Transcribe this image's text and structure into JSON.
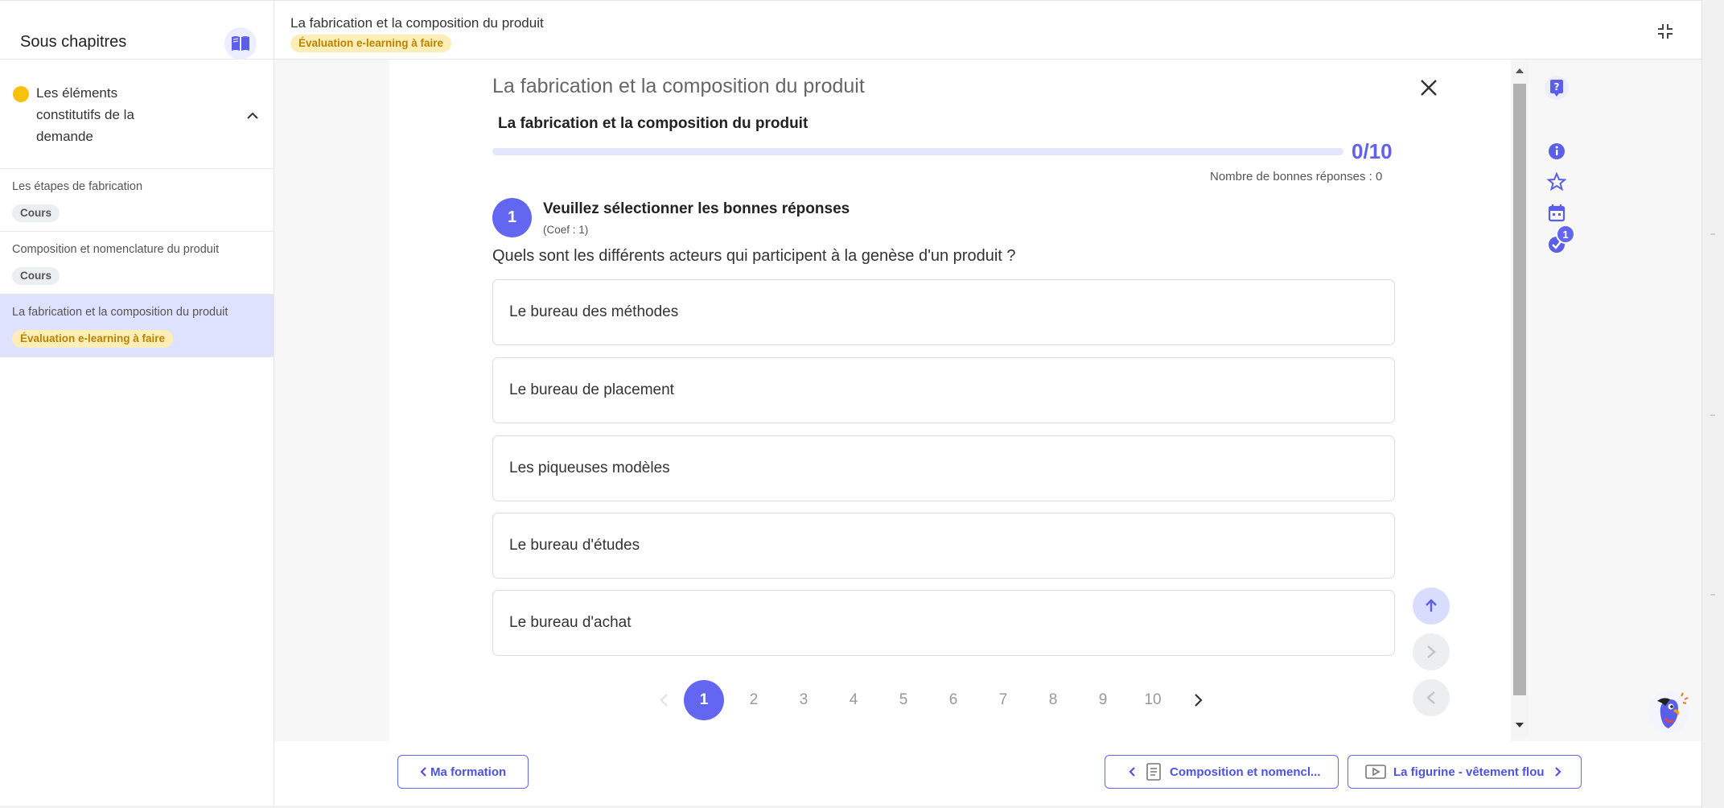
{
  "sidebar": {
    "title": "Sous chapitres",
    "chapter": {
      "label": "Les éléments constitutifs de la demande"
    },
    "items": [
      {
        "label": "Les étapes de fabrication",
        "badge": "Cours",
        "badge_type": "grey"
      },
      {
        "label": "Composition et nomenclature du produit",
        "badge": "Cours",
        "badge_type": "grey"
      },
      {
        "label": "La fabrication et la composition du produit",
        "badge": "Évaluation e-learning à faire",
        "badge_type": "yellow",
        "active": true
      }
    ]
  },
  "header": {
    "title": "La fabrication et la composition du produit",
    "status_badge": "Évaluation e-learning à faire"
  },
  "quiz": {
    "panel_title": "La fabrication et la composition du produit",
    "subtitle": "La fabrication et la composition du produit",
    "progress": {
      "text": "0/10",
      "value": 0,
      "total": 10
    },
    "good_answers": "Nombre de bonnes réponses : 0",
    "question": {
      "number": "1",
      "instruction": "Veuillez sélectionner les bonnes réponses",
      "coef": "(Coef : 1)",
      "text": "Quels sont les différents acteurs qui participent à la genèse d'un produit ?",
      "answers": [
        "Le bureau des méthodes",
        "Le bureau de placement",
        "Les piqueuses modèles",
        "Le bureau d'études",
        "Le bureau d'achat"
      ]
    },
    "pagination": [
      "1",
      "2",
      "3",
      "4",
      "5",
      "6",
      "7",
      "8",
      "9",
      "10"
    ],
    "current_page": "1"
  },
  "rail": {
    "notification_count": "1"
  },
  "footer": {
    "back_label": "Ma formation",
    "prev_label": "Composition et nomencl...",
    "next_label": "La figurine - vêtement flou"
  },
  "colors": {
    "accent": "#6366f1",
    "accent_light": "#dfe2ff",
    "warning_bg": "#fdeeb8",
    "warning_text": "#b98300",
    "chapter_dot": "#f7c20c"
  },
  "icons": {
    "sidebar_toggle": "open-book-icon",
    "chapter_collapse": "chevron-up-icon",
    "fullscreen_exit": "collapse-icon",
    "close": "close-icon",
    "rail": [
      "help-icon",
      "info-icon",
      "star-icon",
      "calendar-icon",
      "badge-check-icon"
    ],
    "footer_prev_type": "document-icon",
    "footer_next_type": "video-icon"
  }
}
